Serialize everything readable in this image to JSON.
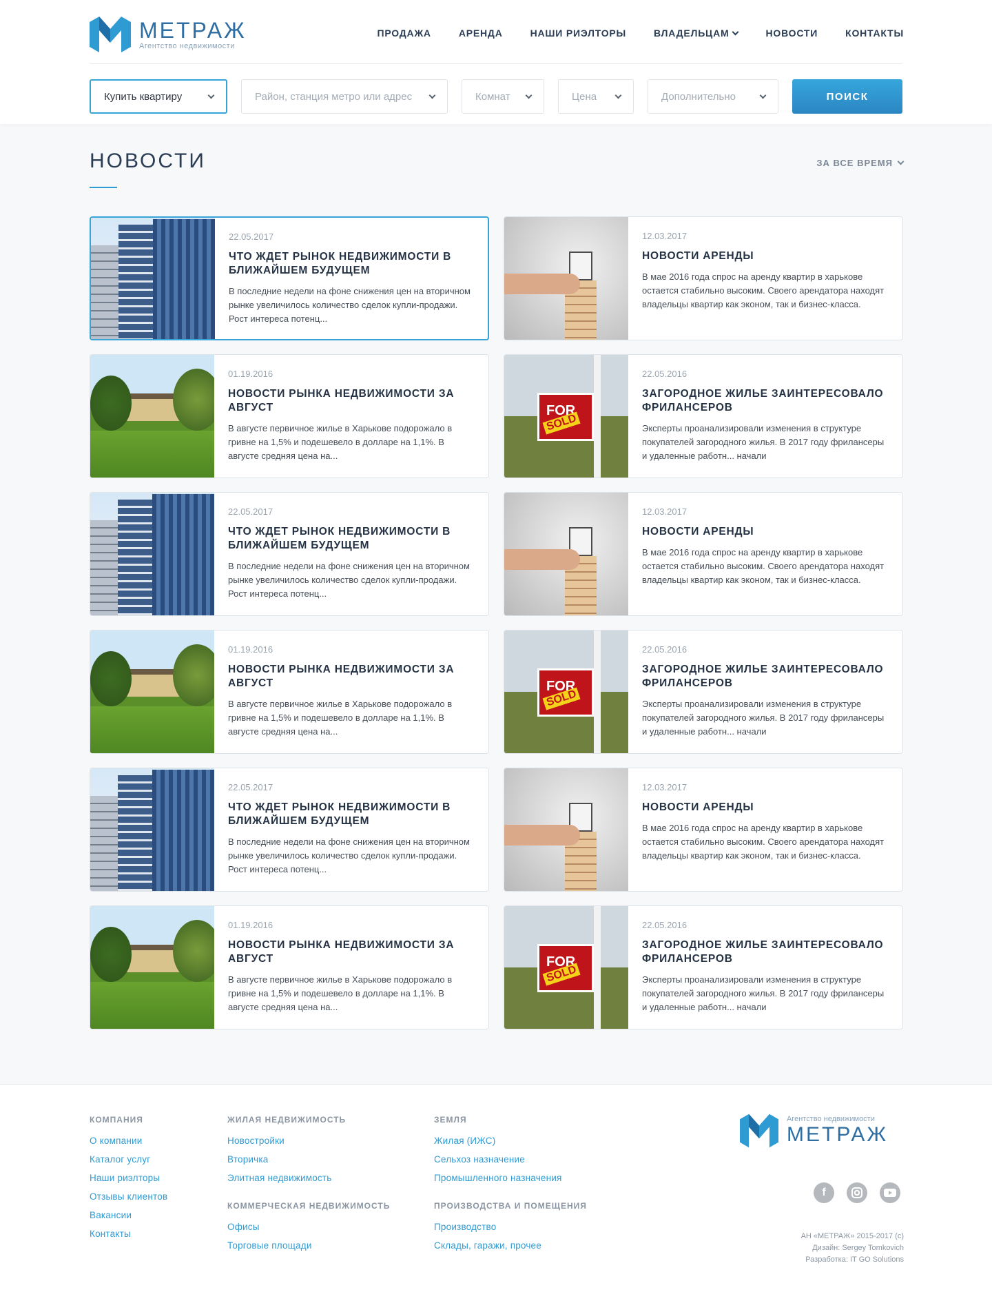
{
  "brand": {
    "name": "МЕТРАЖ",
    "tagline": "Агентство недвижимости",
    "color": "#2f6ea2"
  },
  "nav": [
    {
      "label": "ПРОДАЖА"
    },
    {
      "label": "АРЕНДА"
    },
    {
      "label": "НАШИ РИЭЛТОРЫ"
    },
    {
      "label": "ВЛАДЕЛЬЦАМ",
      "icon": "chevron-down-icon"
    },
    {
      "label": "НОВОСТИ"
    },
    {
      "label": "КОНТАКТЫ"
    }
  ],
  "search": {
    "type": "Купить квартиру",
    "location_placeholder": "Район, станция метро или адрес",
    "rooms_placeholder": "Комнат",
    "price_placeholder": "Цена",
    "extra_placeholder": "Дополнительно",
    "button": "ПОИСК"
  },
  "page": {
    "title": "НОВОСТИ",
    "period": "ЗА ВСЕ ВРЕМЯ"
  },
  "news": [
    {
      "date": "22.05.2017",
      "title": "ЧТО ЖДЕТ РЫНОК НЕДВИЖИМОСТИ В БЛИЖАЙШЕМ БУДУЩЕМ",
      "text": "В последние недели на фоне снижения цен на вторичном рынке увеличилось количество сделок купли-продажи. Рост интереса потенц...",
      "image": "building"
    },
    {
      "date": "12.03.2017",
      "title": "НОВОСТИ АРЕНДЫ",
      "text": "В мае 2016 года спрос на аренду квартир в харькове остается стабильно высоким. Своего арендатора находят владельцы квартир как эконом, так и бизнес-класса.",
      "image": "jenga"
    },
    {
      "date": "01.19.2016",
      "title": "НОВОСТИ РЫНКА НЕДВИЖИМОСТИ ЗА АВГУСТ",
      "text": "В августе первичное жилье в Харькове подорожало в гривне на 1,5% и подешевело в долларе на 1,1%. В августе средняя цена на...",
      "image": "house"
    },
    {
      "date": "22.05.2016",
      "title": "ЗАГОРОДНОЕ ЖИЛЬЕ ЗАИНТЕРЕСОВАЛО ФРИЛАНСЕРОВ",
      "text": "Эксперты проанализировали изменения в структуре покупателей загородного жилья. В 2017 году фрилансеры и удаленные работн... начали",
      "image": "sold"
    },
    {
      "date": "22.05.2017",
      "title": "ЧТО ЖДЕТ РЫНОК НЕДВИЖИМОСТИ В БЛИЖАЙШЕМ БУДУЩЕМ",
      "text": "В последние недели на фоне снижения цен на вторичном рынке увеличилось количество сделок купли-продажи. Рост интереса потенц...",
      "image": "building"
    },
    {
      "date": "12.03.2017",
      "title": "НОВОСТИ АРЕНДЫ",
      "text": "В мае 2016 года спрос на аренду квартир в харькове остается стабильно высоким. Своего арендатора находят владельцы квартир как эконом, так и бизнес-класса.",
      "image": "jenga"
    },
    {
      "date": "01.19.2016",
      "title": "НОВОСТИ РЫНКА НЕДВИЖИМОСТИ ЗА АВГУСТ",
      "text": "В августе первичное жилье в Харькове подорожало в гривне на 1,5% и подешевело в долларе на 1,1%. В августе средняя цена на...",
      "image": "house"
    },
    {
      "date": "22.05.2016",
      "title": "ЗАГОРОДНОЕ ЖИЛЬЕ ЗАИНТЕРЕСОВАЛО ФРИЛАНСЕРОВ",
      "text": "Эксперты проанализировали изменения в структуре покупателей загородного жилья. В 2017 году фрилансеры и удаленные работн... начали",
      "image": "sold"
    },
    {
      "date": "22.05.2017",
      "title": "ЧТО ЖДЕТ РЫНОК НЕДВИЖИМОСТИ В БЛИЖАЙШЕМ БУДУЩЕМ",
      "text": "В последние недели на фоне снижения цен на вторичном рынке увеличилось количество сделок купли-продажи. Рост интереса потенц...",
      "image": "building"
    },
    {
      "date": "12.03.2017",
      "title": "НОВОСТИ АРЕНДЫ",
      "text": "В мае 2016 года спрос на аренду квартир в харькове остается стабильно высоким. Своего арендатора находят владельцы квартир как эконом, так и бизнес-класса.",
      "image": "jenga"
    },
    {
      "date": "01.19.2016",
      "title": "НОВОСТИ РЫНКА НЕДВИЖИМОСТИ ЗА АВГУСТ",
      "text": "В августе первичное жилье в Харькове подорожало в гривне на 1,5% и подешевело в долларе на 1,1%. В августе средняя цена на...",
      "image": "house"
    },
    {
      "date": "22.05.2016",
      "title": "ЗАГОРОДНОЕ ЖИЛЬЕ ЗАИНТЕРЕСОВАЛО ФРИЛАНСЕРОВ",
      "text": "Эксперты проанализировали изменения в структуре покупателей загородного жилья. В 2017 году фрилансеры и удаленные работн... начали",
      "image": "sold"
    }
  ],
  "sold_sign": {
    "top": "FOR",
    "stamp": "SOLD"
  },
  "footer": {
    "company": {
      "heading": "КОМПАНИЯ",
      "links": [
        "О компании",
        "Каталог услуг",
        "Наши риэлторы",
        "Отзывы клиентов",
        "Вакансии",
        "Контакты"
      ]
    },
    "residential": {
      "heading": "ЖИЛАЯ НЕДВИЖИМОСТЬ",
      "links": [
        "Новостройки",
        "Вторичка",
        "Элитная недвижимость"
      ]
    },
    "commercial": {
      "heading": "КОММЕРЧЕСКАЯ НЕДВИЖИМОСТЬ",
      "links": [
        "Офисы",
        "Торговые площади"
      ]
    },
    "land": {
      "heading": "ЗЕМЛЯ",
      "links": [
        "Жилая (ИЖС)",
        "Сельхоз назначение",
        "Промышленного назначения"
      ]
    },
    "production": {
      "heading": "ПРОИЗВОДСТВА И ПОМЕЩЕНИЯ",
      "links": [
        "Производство",
        "Склады, гаражи, прочее"
      ]
    },
    "social": [
      "facebook-icon",
      "instagram-icon",
      "youtube-icon"
    ],
    "copyright": "АН «МЕТРАЖ» 2015-2017 (с)",
    "design": "Дизайн: Sergey Tomkovich",
    "dev": "Разработка: IT GO Solutions"
  },
  "colors": {
    "accent": "#2f9bd3",
    "button": "#2b86c2",
    "heading": "#2b3d55"
  }
}
